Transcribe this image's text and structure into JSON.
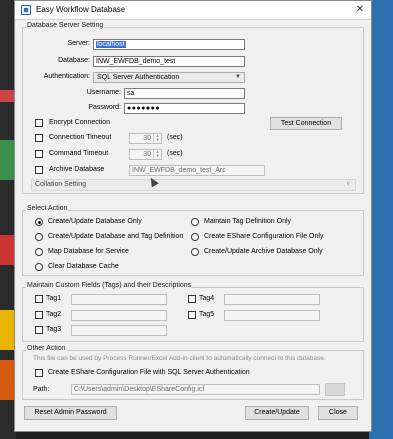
{
  "window": {
    "title": "Easy Workflow Database"
  },
  "server_setting": {
    "group_title": "Database Server Setting",
    "server_label": "Server:",
    "server_value": "localhost",
    "database_label": "Database:",
    "database_value": "INW_EWFDB_demo_test",
    "authentication_label": "Authentication:",
    "authentication_value": "SQL Server Authentication",
    "username_label": "Username:",
    "username_value": "sa",
    "password_label": "Password:",
    "password_value": "●●●●●●●",
    "encrypt_label": "Encrypt Connection",
    "test_connection_label": "Test Connection",
    "connection_timeout_label": "Connection Timeout",
    "connection_timeout_value": "30",
    "command_timeout_label": "Command Timeout",
    "command_timeout_value": "30",
    "sec_label": "(sec)",
    "archive_label": "Archive Database",
    "archive_value": "INW_EWFDB_demo_test_Arc",
    "collation_label": "Collation Setting"
  },
  "select_action": {
    "group_title": "Select Action",
    "options": [
      "Create/Update Database Only",
      "Create/Update Database and Tag Definition",
      "Map Database for Service",
      "Clear Database Cache",
      "Maintain Tag Definition Only",
      "Create EShare Configuration File Only",
      "Create/Update Archive Database Only"
    ],
    "selected": "Create/Update Database Only"
  },
  "custom_fields": {
    "group_title": "Maintain Custom Fields (Tags) and their Descriptions",
    "tags": [
      "Tag1",
      "Tag2",
      "Tag3",
      "Tag4",
      "Tag5"
    ]
  },
  "other_action": {
    "group_title": "Other Action",
    "note": "This file can be used by Process Runner/Excel Add-in client to automatically connect to this database.",
    "eshare_label": "Create EShare Configuration File with SQL Server Authentication",
    "path_label": "Path:",
    "path_value": "C:\\Users\\admin\\Desktop\\EShareConfig.icf"
  },
  "footer": {
    "reset_label": "Reset Admin Password",
    "create_label": "Create/Update",
    "close_label": "Close"
  },
  "colors": {
    "selection": "#3b6fd4",
    "dialog_bg": "#f0f0f0",
    "background": "#1e1e1e",
    "accent_right": "#2e6fb0"
  }
}
